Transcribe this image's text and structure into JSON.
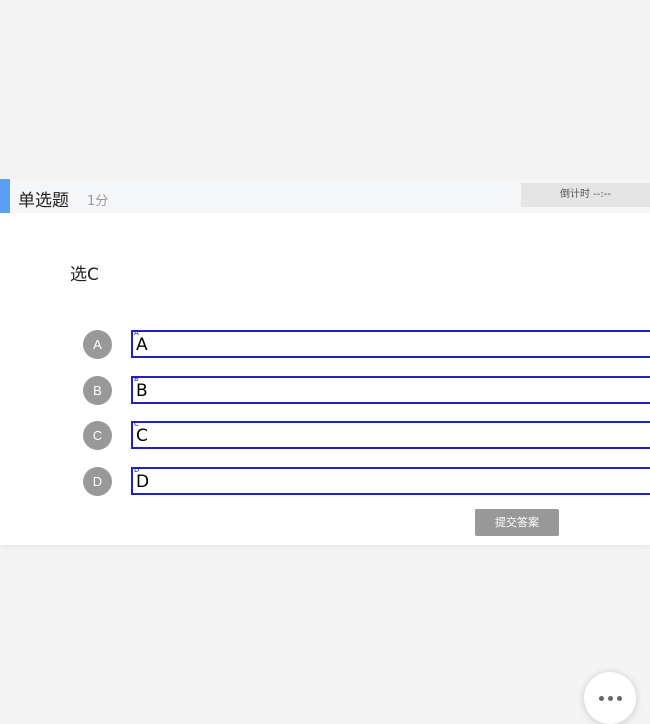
{
  "question": {
    "type_label": "单选题",
    "score_label": "1分",
    "timer_label": "倒计时 --:--",
    "stem": "选C"
  },
  "options": [
    {
      "letter": "A",
      "tag": "A",
      "text": "A"
    },
    {
      "letter": "B",
      "tag": "B",
      "text": "B"
    },
    {
      "letter": "C",
      "tag": "C",
      "text": "C"
    },
    {
      "letter": "D",
      "tag": "D",
      "text": "D"
    }
  ],
  "actions": {
    "submit_label": "提交答案"
  },
  "colors": {
    "accent": "#5b9ff5",
    "option_border": "#2222bb",
    "option_circle": "#999999",
    "submit_bg": "#999999"
  },
  "icons": {
    "fab": "more-horizontal-icon"
  }
}
